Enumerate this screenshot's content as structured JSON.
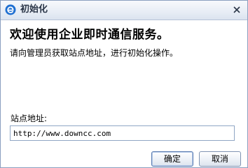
{
  "window": {
    "title": "初始化",
    "icon": "ie-e-icon",
    "close_icon": "close-x-icon"
  },
  "main": {
    "heading": "欢迎使用企业即时通信服务。",
    "description": "请向管理员获取站点地址，进行初始化操作。",
    "site_label": "站点地址:",
    "site_value": "http://www.downcc.com"
  },
  "buttons": {
    "ok_label": "确定",
    "cancel_label": "取消"
  },
  "colors": {
    "titlebar": "#e9eef6",
    "border": "#8a9fbf",
    "icon_blue": "#1f6fd1"
  }
}
